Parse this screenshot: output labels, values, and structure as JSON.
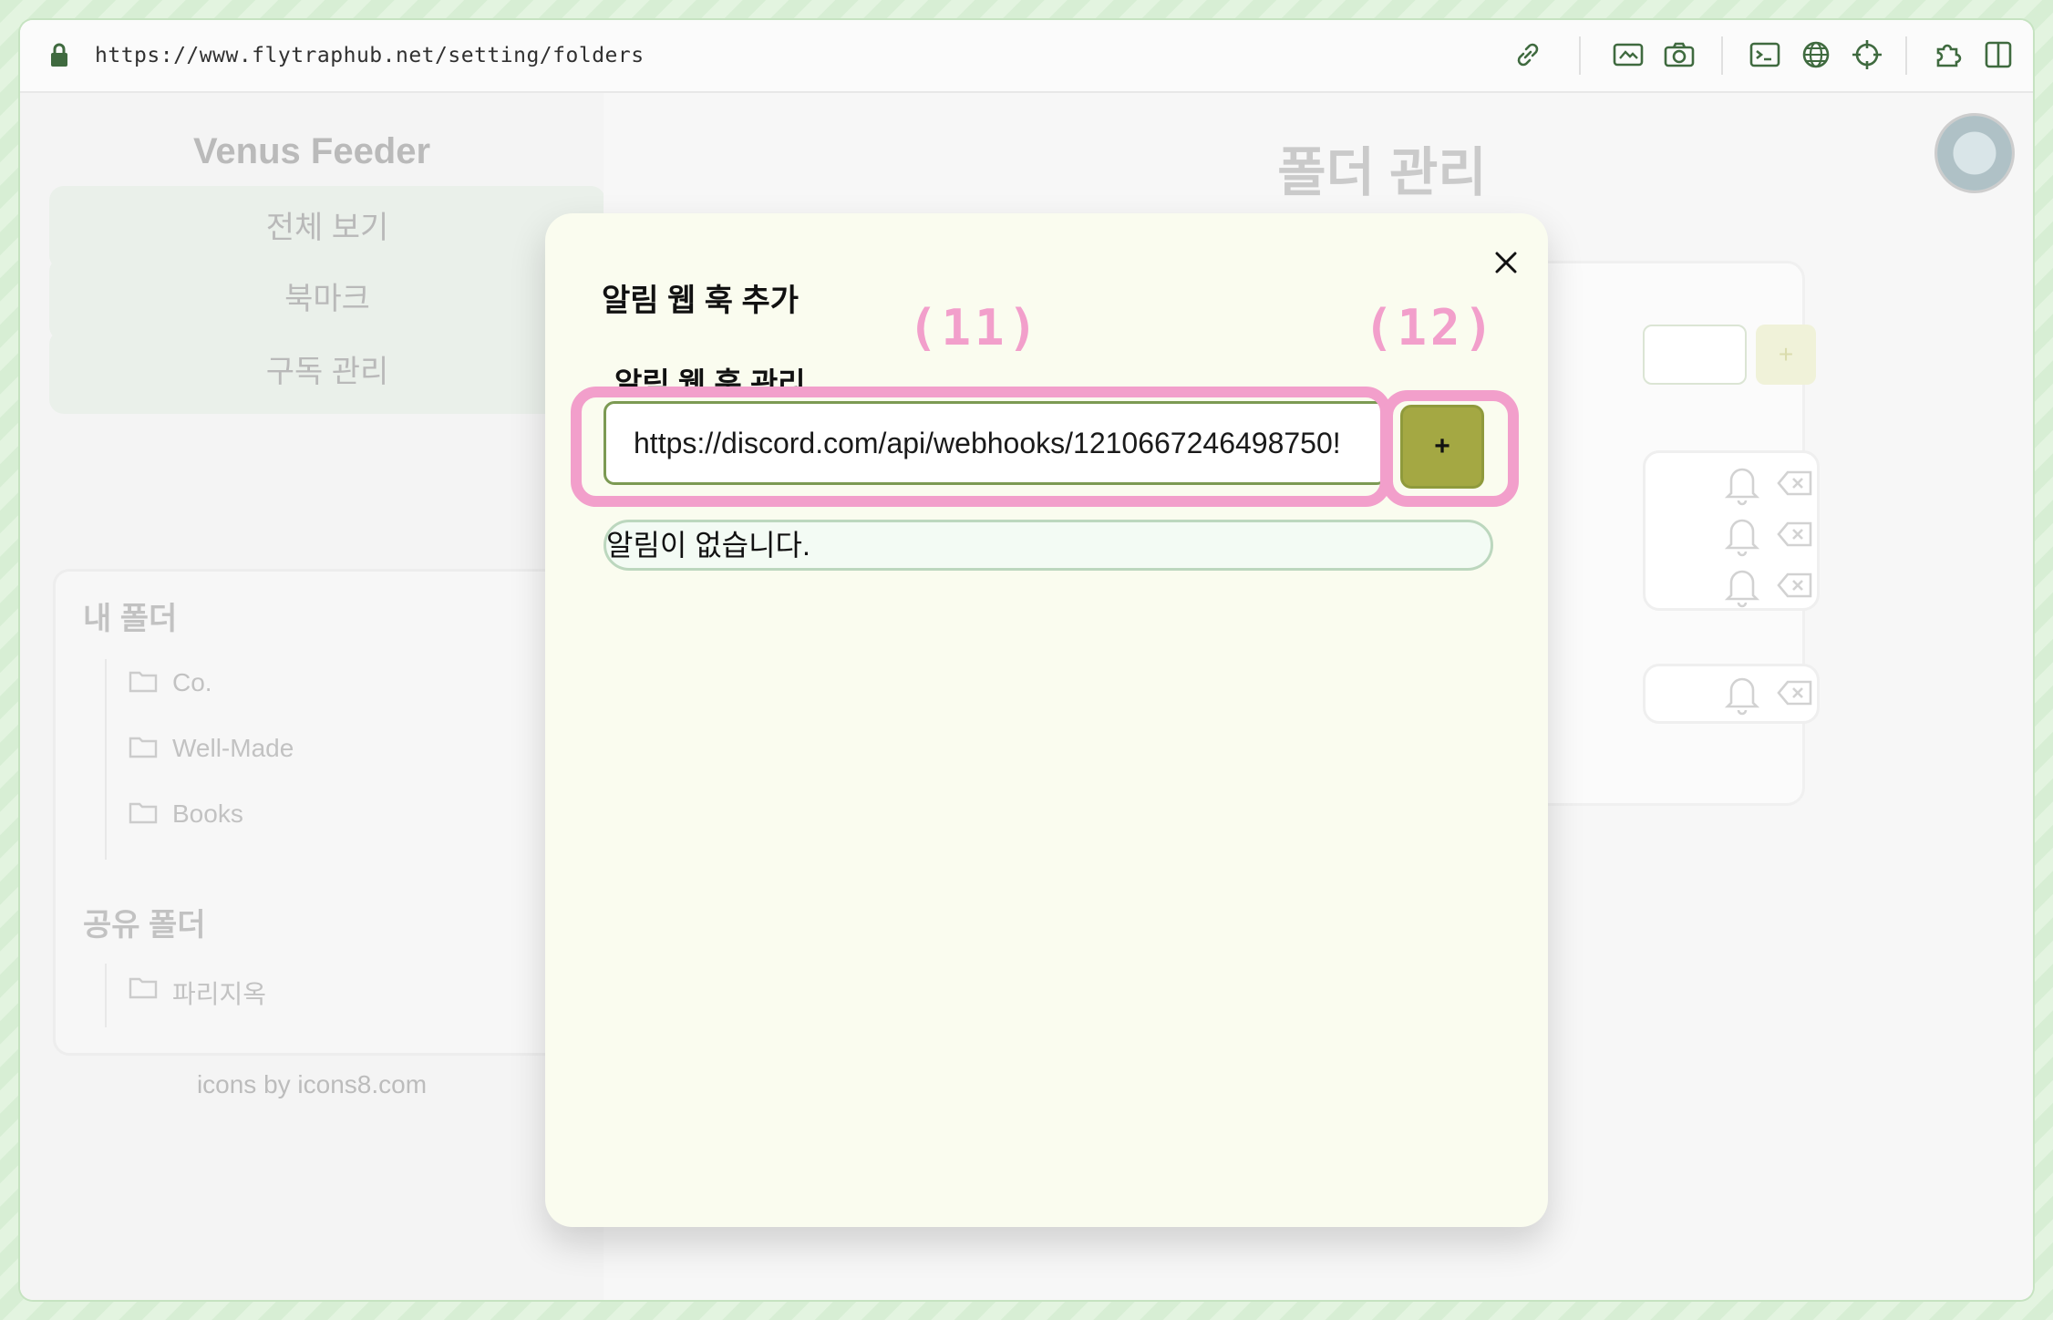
{
  "browser": {
    "url": "https://www.flytraphub.net/setting/folders",
    "icons": [
      "lock-icon",
      "link-icon",
      "screenshot-icon",
      "camera-icon",
      "terminal-icon",
      "globe-icon",
      "crosshair-icon",
      "extensions-icon",
      "sidebar-icon"
    ]
  },
  "sidebar": {
    "brand": "Venus Feeder",
    "nav": [
      "전체 보기",
      "북마크",
      "구독 관리"
    ],
    "my_folders_title": "내 폴더",
    "my_folders": [
      "Co.",
      "Well-Made",
      "Books"
    ],
    "shared_folders_title": "공유 폴더",
    "shared_folders": [
      "파리지옥"
    ],
    "credit": "icons by icons8.com"
  },
  "main": {
    "title": "폴더 관리",
    "add_button_label": "+"
  },
  "modal": {
    "title": "알림 웹 훅 추가",
    "subtitle": "알림 웹 훅 관리",
    "webhook_value": "https://discord.com/api/webhooks/1210667246498750!",
    "add_label": "+",
    "empty_text": "알림이 없습니다."
  },
  "annotations": {
    "input_badge": "(11)",
    "button_badge": "(12)",
    "highlight_color": "#f29fcb"
  },
  "colors": {
    "accent_olive": "#a4a843",
    "input_border": "#7c9a53",
    "modal_bg": "#fafcef"
  }
}
